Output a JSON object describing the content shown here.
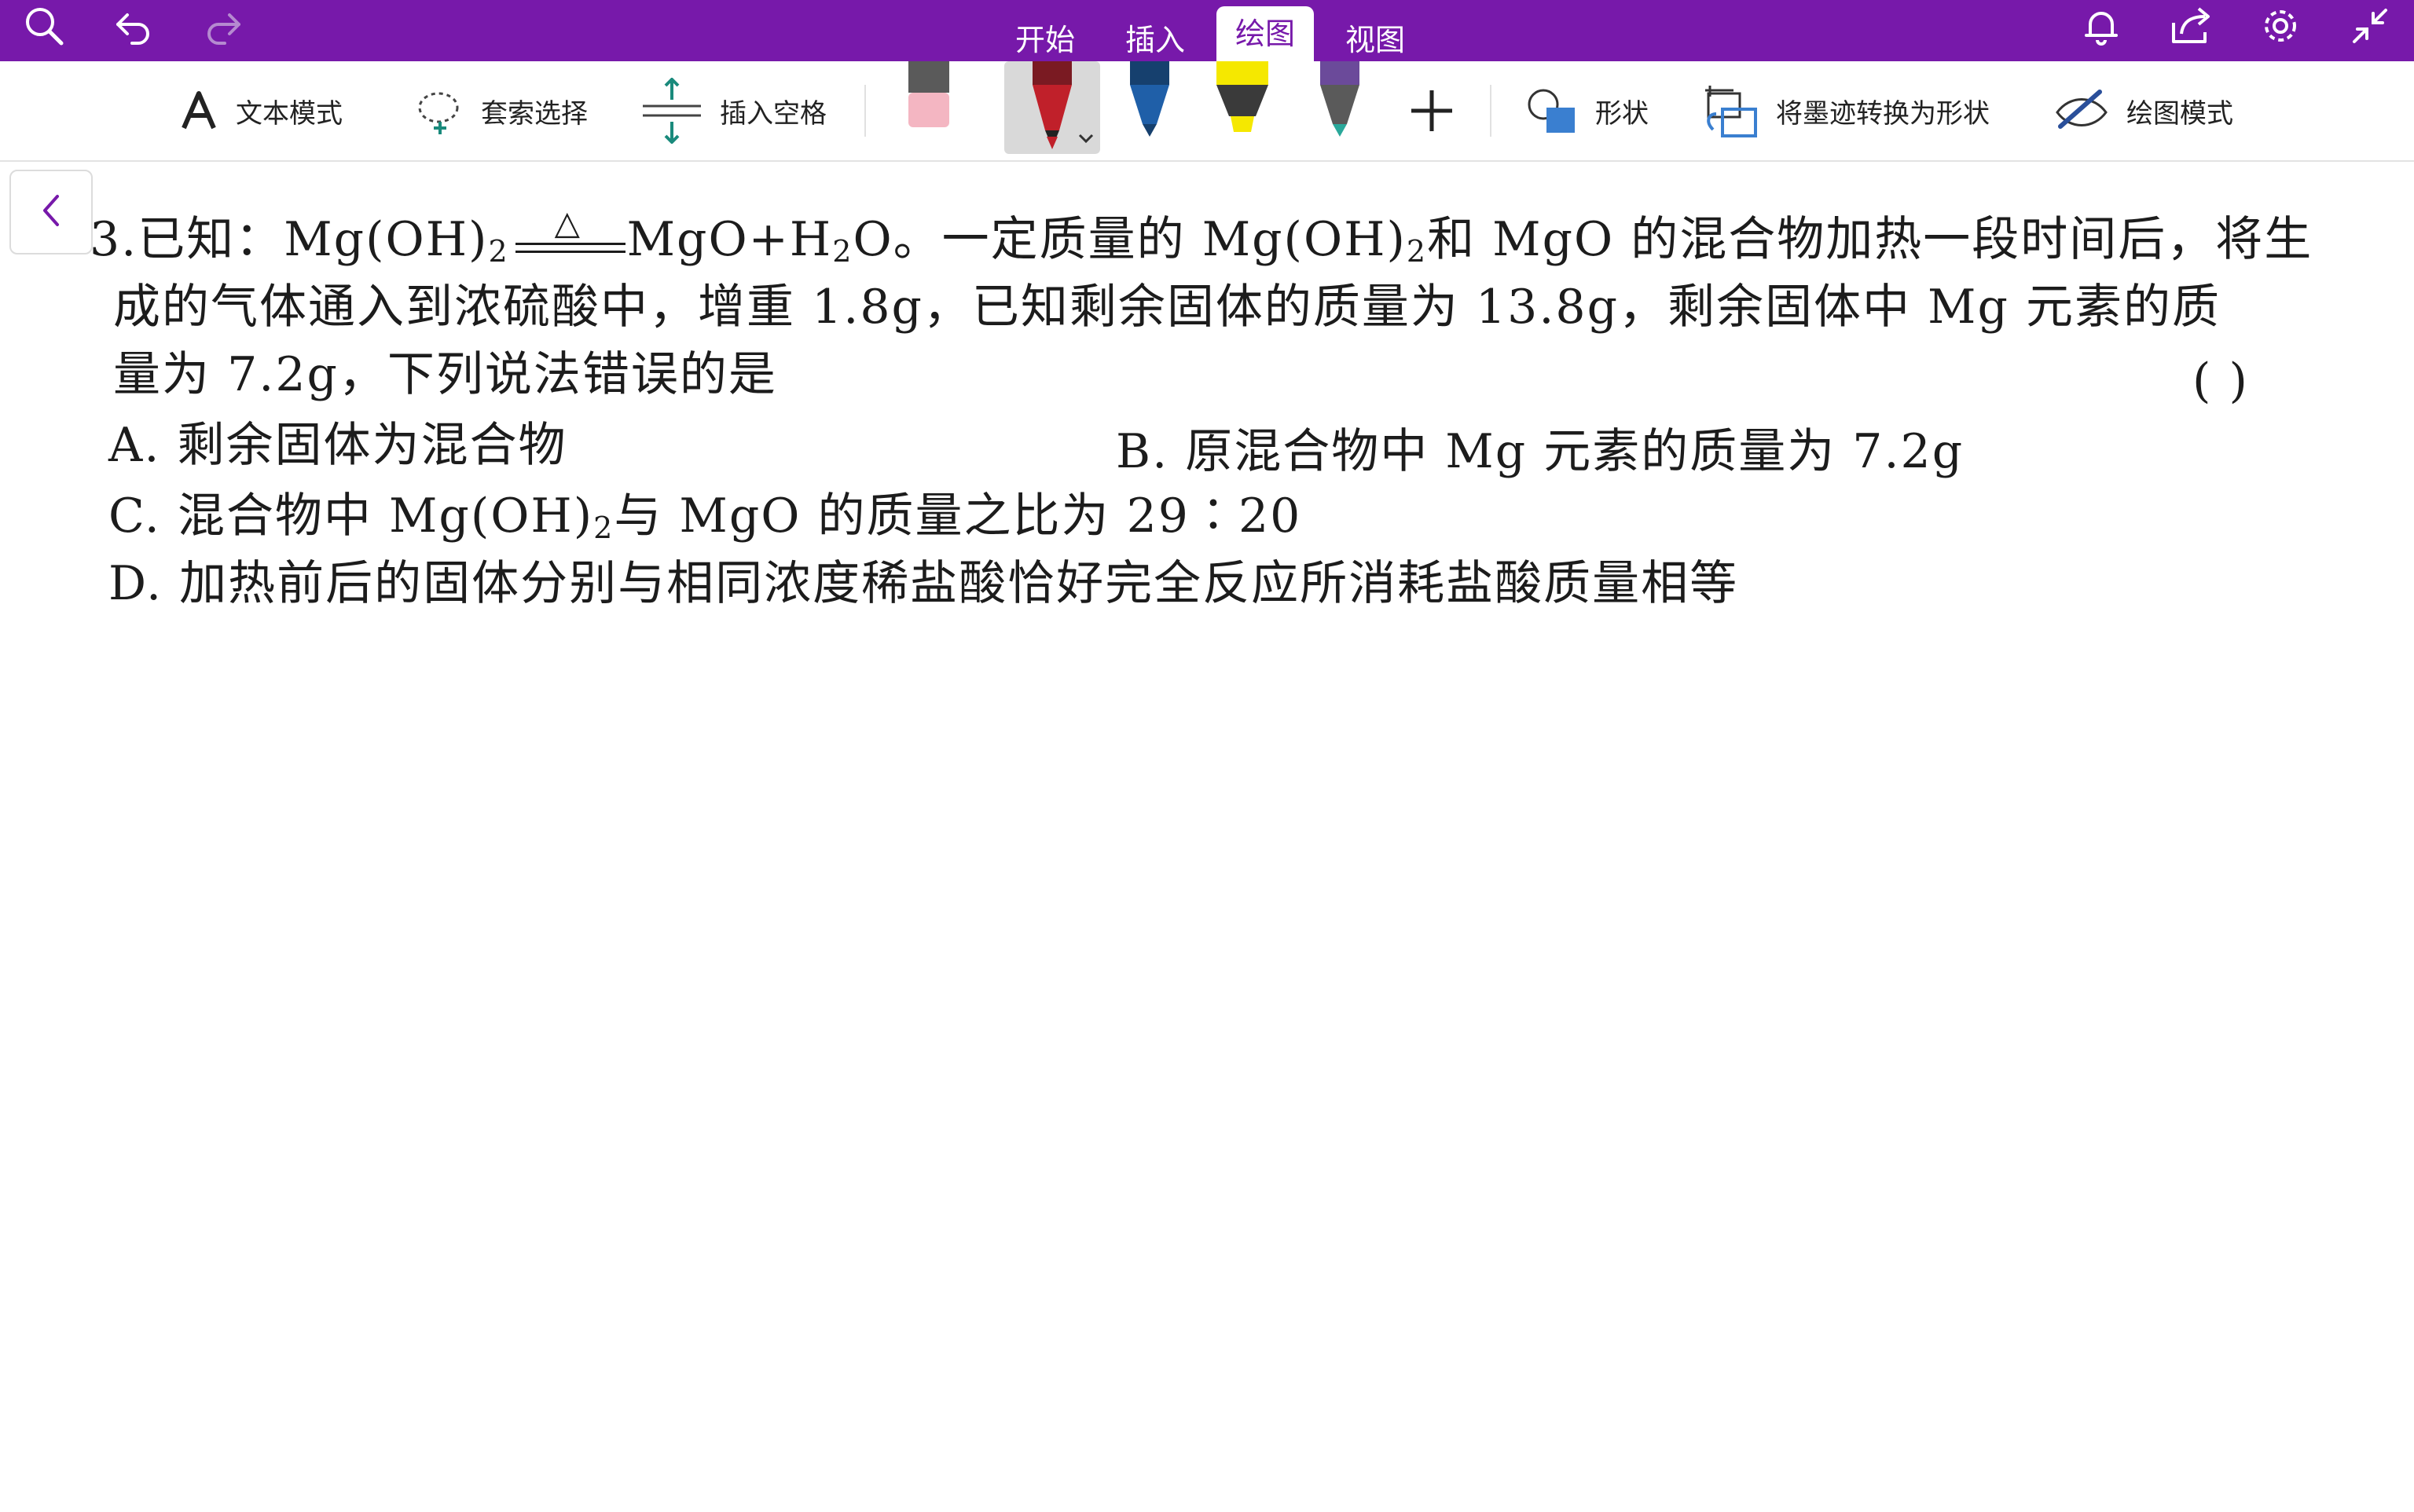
{
  "app": {
    "accent": "#7719aa",
    "tabs": [
      {
        "label": "开始",
        "active": false
      },
      {
        "label": "插入",
        "active": false
      },
      {
        "label": "绘图",
        "active": true
      },
      {
        "label": "视图",
        "active": false
      }
    ],
    "top_icons": [
      "search-icon",
      "undo-icon",
      "redo-icon",
      "bell-icon",
      "share-icon",
      "gear-icon",
      "collapse-icon"
    ]
  },
  "ribbon": {
    "text_mode_label": "文本模式",
    "lasso_label": "套索选择",
    "insert_space_label": "插入空格",
    "shapes_label": "形状",
    "ink_to_shape_label": "将墨迹转换为形状",
    "draw_mode_label": "绘图模式",
    "pens": [
      {
        "name": "eraser",
        "color": "#f4b6c2"
      },
      {
        "name": "red-pen",
        "color": "#c0202a",
        "selected": true
      },
      {
        "name": "blue-pen",
        "color": "#1f5fa8"
      },
      {
        "name": "yellow-highlighter",
        "color": "#f5e800"
      },
      {
        "name": "teal-pen",
        "color": "#2aa89a"
      }
    ]
  },
  "question": {
    "number": "3.",
    "line1_pre": "已知：Mg(OH)",
    "sub2": "2",
    "delta": "△",
    "line1_mid": "MgO+H",
    "line1_mid2": "O。一定质量的 Mg(OH)",
    "line1_post": "和 MgO 的混合物加热一段时间后，将生",
    "line2": "成的气体通入到浓硫酸中，增重 1.8g，已知剩余固体的质量为 13.8g，剩余固体中 Mg 元素的质",
    "line3": "量为 7.2g，下列说法错误的是",
    "bracket": "(        )",
    "optA": "A.  剩余固体为混合物",
    "optB": "B.  原混合物中 Mg 元素的质量为 7.2g",
    "optC_pre": "C.  混合物中 Mg(OH)",
    "optC_post": "与 MgO 的质量之比为 29∶20",
    "optD": "D.  加热前后的固体分别与相同浓度稀盐酸恰好完全反应所消耗盐酸质量相等"
  }
}
